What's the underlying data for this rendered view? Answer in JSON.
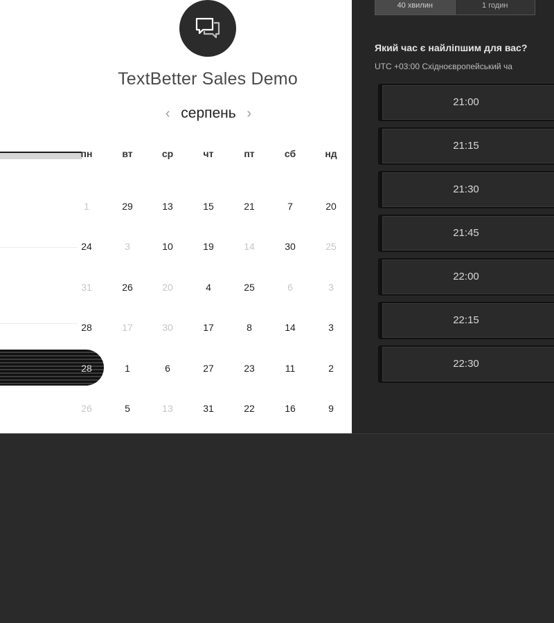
{
  "event": {
    "title": "TextBetter Sales Demo",
    "logo_icon": "chat-bubbles-icon"
  },
  "calendar": {
    "month": "серпень",
    "prev_label": "‹",
    "next_label": "›",
    "weekdays": [
      "пн",
      "вт",
      "ср",
      "чт",
      "пт",
      "сб",
      "нд"
    ],
    "rows": [
      [
        {
          "v": "1",
          "dim": true
        },
        {
          "v": "29",
          "dim": false
        },
        {
          "v": "13",
          "dim": false
        },
        {
          "v": "15",
          "dim": false
        },
        {
          "v": "21",
          "dim": false
        },
        {
          "v": "7",
          "dim": false
        },
        {
          "v": "20",
          "dim": false
        }
      ],
      [
        {
          "v": "24",
          "dim": false
        },
        {
          "v": "3",
          "dim": true
        },
        {
          "v": "10",
          "dim": false
        },
        {
          "v": "19",
          "dim": false
        },
        {
          "v": "14",
          "dim": true
        },
        {
          "v": "30",
          "dim": false
        },
        {
          "v": "25",
          "dim": true
        }
      ],
      [
        {
          "v": "31",
          "dim": true
        },
        {
          "v": "26",
          "dim": false
        },
        {
          "v": "20",
          "dim": true
        },
        {
          "v": "4",
          "dim": false
        },
        {
          "v": "25",
          "dim": false
        },
        {
          "v": "6",
          "dim": true
        },
        {
          "v": "3",
          "dim": true
        }
      ],
      [
        {
          "v": "28",
          "dim": false
        },
        {
          "v": "17",
          "dim": true
        },
        {
          "v": "30",
          "dim": true
        },
        {
          "v": "17",
          "dim": false
        },
        {
          "v": "8",
          "dim": false
        },
        {
          "v": "14",
          "dim": false
        },
        {
          "v": "3",
          "dim": false
        }
      ],
      [
        {
          "v": "28",
          "dim": false,
          "highlight": true
        },
        {
          "v": "1",
          "dim": false
        },
        {
          "v": "6",
          "dim": false
        },
        {
          "v": "27",
          "dim": false
        },
        {
          "v": "23",
          "dim": false
        },
        {
          "v": "11",
          "dim": false
        },
        {
          "v": "2",
          "dim": false
        }
      ],
      [
        {
          "v": "26",
          "dim": true
        },
        {
          "v": "5",
          "dim": false
        },
        {
          "v": "13",
          "dim": true
        },
        {
          "v": "31",
          "dim": false
        },
        {
          "v": "22",
          "dim": false
        },
        {
          "v": "16",
          "dim": false
        },
        {
          "v": "9",
          "dim": false
        }
      ]
    ]
  },
  "duration": {
    "options": [
      "40 хвилин",
      "1 годин"
    ]
  },
  "time_picker": {
    "question": "Який час є найліпшим для вас?",
    "timezone": "UTC +03:00 Східноєвропейський ча",
    "slots": [
      "21:00",
      "21:15",
      "21:30",
      "21:45",
      "22:00",
      "22:15",
      "22:30"
    ]
  },
  "colors": {
    "left_bg": "#ffffff",
    "right_bg": "#262626",
    "page_bg": "#2a2a2a"
  }
}
